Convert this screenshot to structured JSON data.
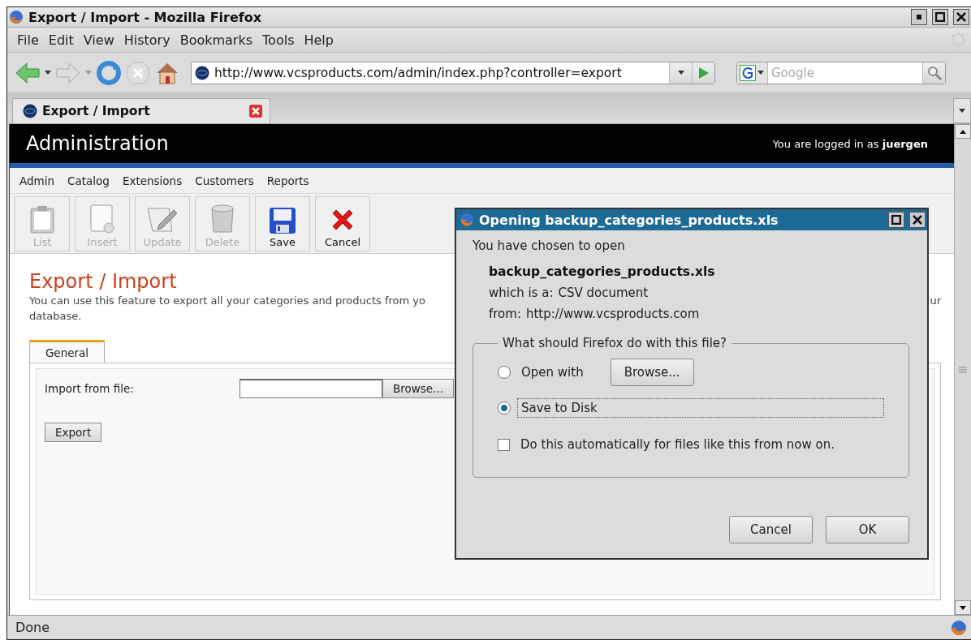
{
  "window": {
    "title": "Export / Import - Mozilla Firefox"
  },
  "menu_bar": [
    "File",
    "Edit",
    "View",
    "History",
    "Bookmarks",
    "Tools",
    "Help"
  ],
  "navigation": {
    "url": "http://www.vcsproducts.com/admin/index.php?controller=export",
    "search_placeholder": "Google"
  },
  "tabs": [
    {
      "label": "Export / Import",
      "selected": true
    }
  ],
  "page": {
    "header_title": "Administration",
    "login_text": "You are logged in as **juergen**",
    "nav": [
      "Admin",
      "Catalog",
      "Extensions",
      "Customers",
      "Reports"
    ],
    "toolbar": [
      {
        "label": "List",
        "kind": "list",
        "disabled": true
      },
      {
        "label": "Insert",
        "kind": "insert",
        "disabled": true
      },
      {
        "label": "Update",
        "kind": "update",
        "disabled": true
      },
      {
        "label": "Delete",
        "kind": "delete",
        "disabled": true
      },
      {
        "label": "Save",
        "kind": "save",
        "disabled": false
      },
      {
        "label": "Cancel",
        "kind": "cancel",
        "disabled": false
      }
    ],
    "heading": "Export / Import",
    "description_start": "You can use this feature to export all your categories and products from yo",
    "description_end": "ur",
    "description_line_2": "database.",
    "form_tabs": [
      {
        "label": "General",
        "selected": true
      }
    ],
    "import_label": "Import from file:",
    "browse_button": "Browse...",
    "export_button": "Export"
  },
  "dialog": {
    "title": "Opening backup_categories_products.xls",
    "intro": "You have chosen to open",
    "file_name": "backup_categories_products.xls",
    "type_label": "which is a:",
    "type_value": "CSV document",
    "from_label": "from:",
    "from_value": "http://www.vcsproducts.com",
    "group_title": "What should Firefox do with this file?",
    "options": [
      {
        "label": "Open with",
        "selected": false,
        "kind": "app"
      },
      {
        "label": "Save to Disk",
        "selected": true,
        "kind": "save"
      }
    ],
    "browse_button": "Browse...",
    "auto_checkbox": {
      "label": "Do this automatically for files like this from now on.",
      "checked": false
    },
    "buttons": [
      "Cancel",
      "OK"
    ]
  },
  "status_bar": {
    "text": "Done"
  }
}
